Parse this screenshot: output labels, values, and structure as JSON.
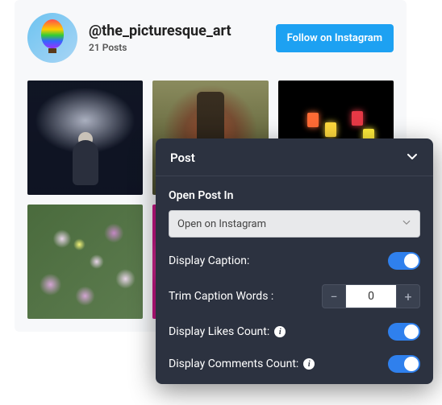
{
  "profile": {
    "handle": "@the_picturesque_art",
    "posts_label": "21 Posts"
  },
  "follow_button": "Follow on Instagram",
  "panel": {
    "title": "Post",
    "section_open_label": "Open Post In",
    "select_value": "Open on Instagram",
    "display_caption_label": "Display Caption:",
    "display_caption_on": true,
    "trim_label": "Trim Caption Words :",
    "trim_value": "0",
    "display_likes_label": "Display Likes Count:",
    "display_likes_on": true,
    "display_comments_label": "Display Comments Count:",
    "display_comments_on": true
  },
  "icons": {
    "chevron_down": "chevron-down-icon",
    "info": "info-icon",
    "minus": "−",
    "plus": "+"
  }
}
